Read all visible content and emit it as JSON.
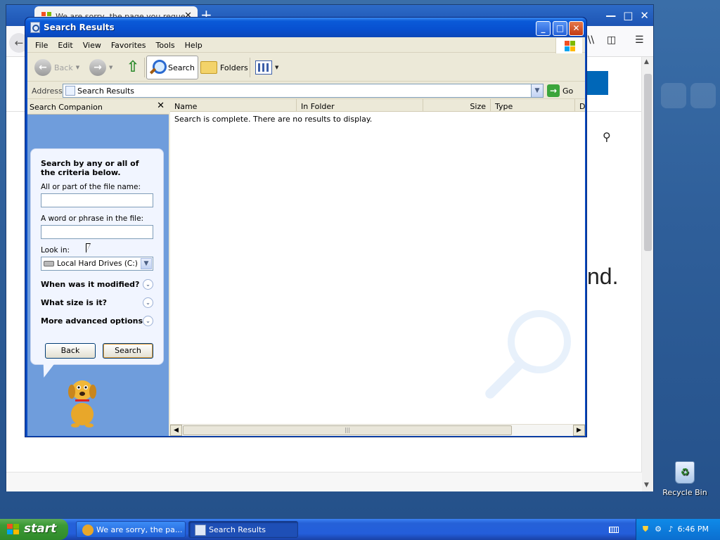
{
  "browser": {
    "tab_title": "We are sorry, the page you reque",
    "new_tab_glyph": "+",
    "content_partial_text": "nd.",
    "scroll_up": "▲",
    "scroll_down": "▼"
  },
  "window": {
    "title": "Search Results",
    "controls": {
      "minimize": "_",
      "maximize": "□",
      "close": "✕"
    }
  },
  "menubar": {
    "items": [
      "File",
      "Edit",
      "View",
      "Favorites",
      "Tools",
      "Help"
    ]
  },
  "toolbar": {
    "back_label": "Back",
    "search_label": "Search",
    "folders_label": "Folders"
  },
  "address": {
    "label": "Address",
    "value": "Search Results",
    "go_label": "Go"
  },
  "companion": {
    "title": "Search Companion",
    "close_glyph": "✕",
    "heading": "Search by any or all of the criteria below.",
    "filename_label": "All or part of the file name:",
    "filename_value": "",
    "phrase_label": "A word or phrase in the file:",
    "phrase_value": "",
    "lookin_label": "Look in:",
    "lookin_value": "Local Hard Drives (C:)",
    "advanced": [
      "When was it modified?",
      "What size is it?",
      "More advanced options"
    ],
    "back_button": "Back",
    "search_button": "Search"
  },
  "results": {
    "columns": [
      "Name",
      "In Folder",
      "Size",
      "Type",
      "D"
    ],
    "status": "Search is complete. There are no results to display."
  },
  "desktop": {
    "recycle_bin_label": "Recycle Bin"
  },
  "taskbar": {
    "start_label": "start",
    "items": [
      {
        "label": "We are sorry, the pa...",
        "active": false
      },
      {
        "label": "Search Results",
        "active": true
      }
    ],
    "clock": "6:46 PM"
  },
  "colors": {
    "xp_blue": "#0a4ac0",
    "companion_blue": "#6f9ddc",
    "start_green": "#3c9a36",
    "window_face": "#ece9d8"
  }
}
